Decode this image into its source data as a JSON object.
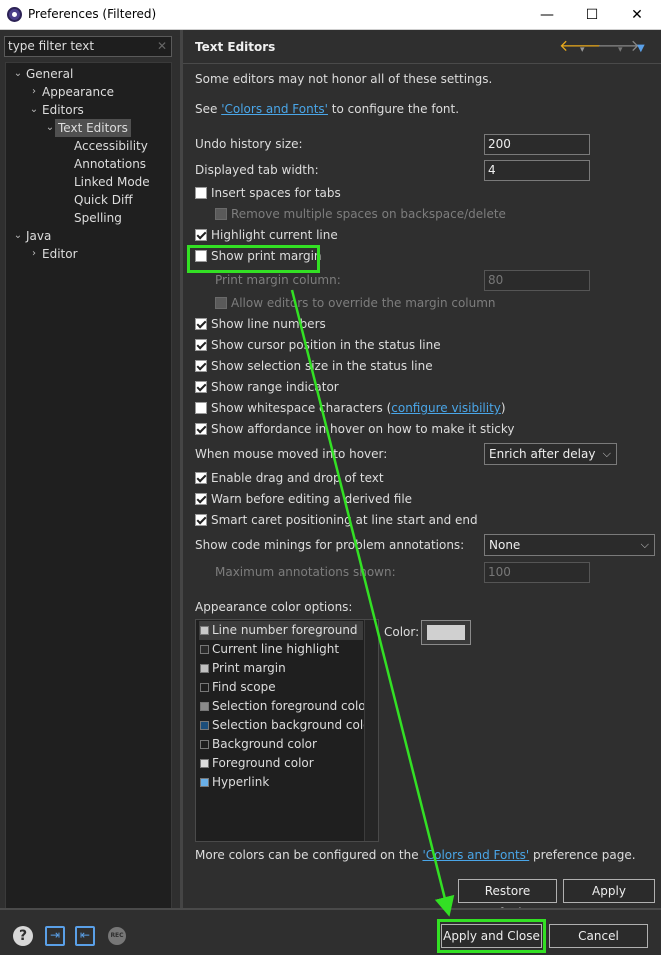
{
  "window": {
    "title": "Preferences (Filtered)",
    "min": "—",
    "max": "☐",
    "close": "✕"
  },
  "left": {
    "filter_placeholder": "type filter text",
    "filter_clear": "✕",
    "tree": [
      {
        "label": "General",
        "arrow": "⌄"
      },
      {
        "label": "Appearance",
        "arrow": "›"
      },
      {
        "label": "Editors",
        "arrow": "⌄"
      },
      {
        "label": "Text Editors",
        "arrow": "⌄"
      },
      {
        "label": "Accessibility"
      },
      {
        "label": "Annotations"
      },
      {
        "label": "Linked Mode"
      },
      {
        "label": "Quick Diff"
      },
      {
        "label": "Spelling"
      },
      {
        "label": "Java",
        "arrow": "⌄"
      },
      {
        "label": "Editor",
        "arrow": "›"
      }
    ]
  },
  "right": {
    "header": "Text Editors",
    "nav": {
      "back": "🡐",
      "drop": "▾",
      "forward": "🡒",
      "menu": "▼"
    },
    "note": "Some editors may not honor all of these settings.",
    "see_prefix": "See ",
    "colors_link": "'Colors and Fonts'",
    "see_suffix": " to configure the font.",
    "undo_label": "Undo history size:",
    "undo_value": "200",
    "tab_label": "Displayed tab width:",
    "tab_value": "4",
    "insert_spaces": "Insert spaces for tabs",
    "remove_spaces": "Remove multiple spaces on backspace/delete",
    "highlight_line": "Highlight current line",
    "show_print_margin": "Show print margin",
    "print_margin_column": "Print margin column:",
    "print_margin_value": "80",
    "allow_override": "Allow editors to override the margin column",
    "show_line_numbers": "Show line numbers",
    "show_cursor_pos": "Show cursor position in the status line",
    "show_selection_size": "Show selection size in the status line",
    "show_range": "Show range indicator",
    "show_whitespace": "Show whitespace characters (",
    "configure_visibility": "configure visibility",
    "close_paren": ")",
    "show_affordance": "Show affordance in hover on how to make it sticky",
    "hover_label": "When mouse moved into hover:",
    "hover_value": "Enrich after delay",
    "drag_drop": "Enable drag and drop of text",
    "warn_derived": "Warn before editing a derived file",
    "smart_caret": "Smart caret positioning at line start and end",
    "minings_label": "Show code minings for problem annotations:",
    "minings_value": "None",
    "max_annotations": "Maximum annotations shown:",
    "max_annotations_value": "100",
    "appearance_label": "Appearance color options:",
    "color_label": "Color:",
    "color_chip": "#d0d0d0",
    "color_options": [
      {
        "label": "Line number foreground",
        "color": "#c8c8c8"
      },
      {
        "label": "Current line highlight",
        "color": "#2a2a2a"
      },
      {
        "label": "Print margin",
        "color": "#c0c0c0"
      },
      {
        "label": "Find scope",
        "color": "#1e1e1e"
      },
      {
        "label": "Selection foreground color",
        "color": "#8a8a8a"
      },
      {
        "label": "Selection background color",
        "color": "#1b4d7a"
      },
      {
        "label": "Background color",
        "color": "#1e1e1e"
      },
      {
        "label": "Foreground color",
        "color": "#dddddd"
      },
      {
        "label": "Hyperlink",
        "color": "#6ab0e8"
      }
    ],
    "more_prefix": "More colors can be configured on the ",
    "more_link": "'Colors and Fonts'",
    "more_suffix": " preference page.",
    "restore_defaults": "Restore Defaults",
    "apply": "Apply"
  },
  "bottom": {
    "help": "?",
    "import": "⇥",
    "export": "⇤",
    "record": "REC",
    "apply_close": "Apply and Close",
    "cancel": "Cancel"
  },
  "annotation_color": "#33e024"
}
